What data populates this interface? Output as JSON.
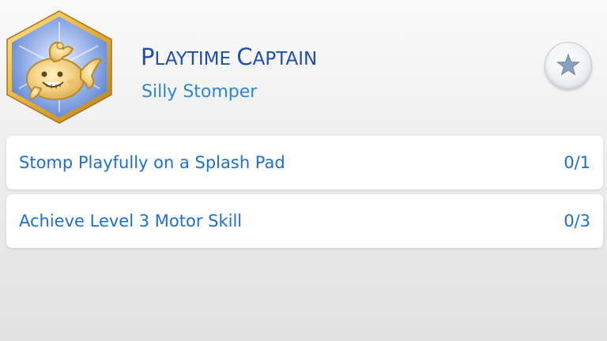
{
  "aspiration": {
    "title": "Playtime Captain",
    "subtitle": "Silly Stomper",
    "badge_icon": "whale-toy-medal-icon",
    "favorite_icon": "star-icon"
  },
  "goals": [
    {
      "label": "Stomp Playfully on a Splash Pad",
      "progress": "0/1"
    },
    {
      "label": "Achieve Level 3 Motor Skill",
      "progress": "0/3"
    }
  ],
  "colors": {
    "title": "#1d4fb0",
    "subtitle": "#2f86d6",
    "goal_text": "#1e6ed4",
    "badge_border": "#e6b73e",
    "badge_fill": "#7f9fe0",
    "row_background": "#ffffff"
  }
}
